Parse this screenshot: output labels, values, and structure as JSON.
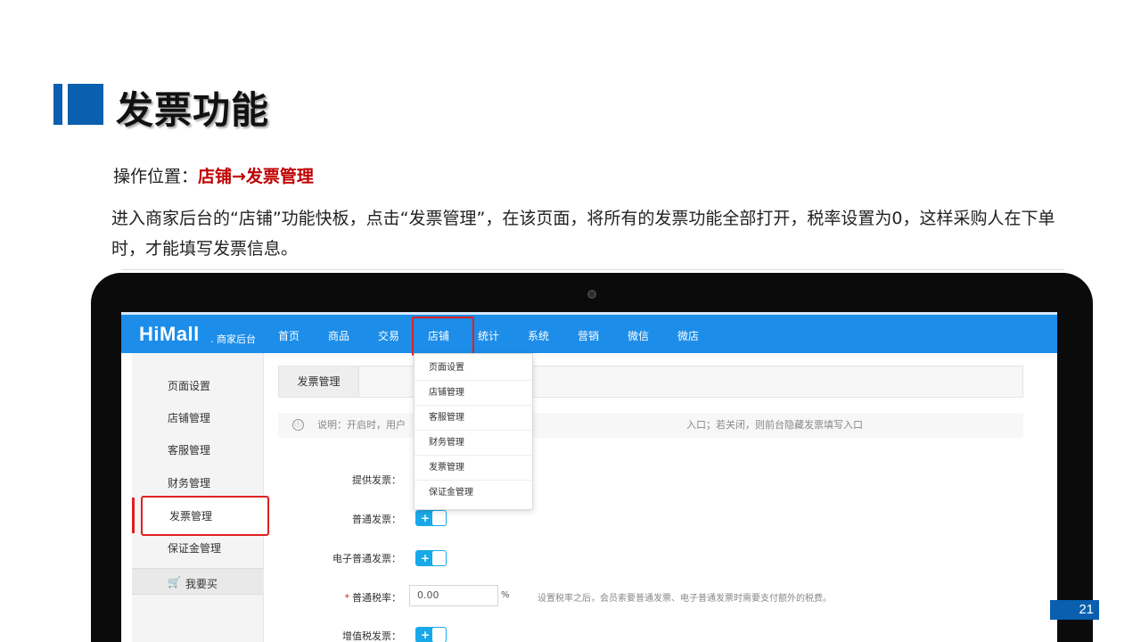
{
  "slide": {
    "title": "发票功能",
    "op_label": "操作位置：",
    "op_value": "店铺→发票管理",
    "description": "进入商家后台的“店铺”功能快板，点击“发票管理”，在该页面，将所有的发票功能全部打开，税率设置为0，这样采购人在下单时，才能填写发票信息。",
    "page_number": "21"
  },
  "app": {
    "logo": "HiMall",
    "logo_sub": ". 商家后台",
    "nav": [
      "首页",
      "商品",
      "交易",
      "店铺",
      "统计",
      "系统",
      "营销",
      "微信",
      "微店"
    ],
    "active_nav": "店铺",
    "sidebar": [
      "页面设置",
      "店铺管理",
      "客服管理",
      "财务管理",
      "发票管理",
      "保证金管理"
    ],
    "sidebar_active": "发票管理",
    "buy_label": "我要买",
    "tab": "发票管理",
    "notice_icon": "ⓘ",
    "notice_part1": "说明：开启时，用户",
    "notice_part2": "入口；若关闭，则前台隐藏发票填写入口",
    "dropdown": [
      "页面设置",
      "店铺管理",
      "客服管理",
      "财务管理",
      "发票管理",
      "保证金管理"
    ],
    "form": {
      "provide_invoice": "提供发票：",
      "normal_invoice": "普通发票：",
      "e_invoice": "电子普通发票：",
      "rate_label": "普通税率：",
      "rate_required": "*",
      "rate_value": "0.00",
      "rate_unit": "%",
      "rate_hint": "设置税率之后，会员索要普通发票、电子普通发票时需要支付额外的税费。",
      "vat_invoice": "增值税发票：",
      "toggle_symbol": "+"
    }
  },
  "colors": {
    "accent_blue": "#0a5fae",
    "nav_blue": "#1c8de8",
    "highlight_red": "#e02020",
    "toggle_blue": "#18a9e8",
    "op_red": "#c00000"
  }
}
